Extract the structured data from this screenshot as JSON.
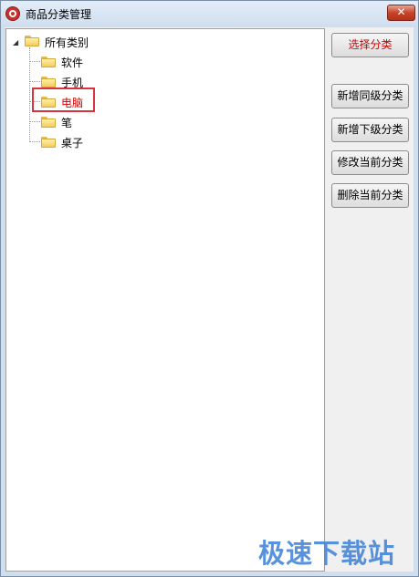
{
  "window": {
    "title": "商品分类管理",
    "close_label": "✕"
  },
  "tree": {
    "root": {
      "label": "所有类别",
      "expander": "◢",
      "expanded": true
    },
    "children": [
      {
        "label": "软件"
      },
      {
        "label": "手机"
      },
      {
        "label": "电脑",
        "selected": true
      },
      {
        "label": "笔"
      },
      {
        "label": "桌子"
      }
    ]
  },
  "buttons": {
    "select": "选择分类",
    "add_sibling": "新增同级分类",
    "add_child": "新增下级分类",
    "edit_current": "修改当前分类",
    "delete_current": "删除当前分类"
  },
  "watermark": "极速下载站",
  "colors": {
    "selected_text": "#d00000",
    "highlight_border": "#d9333f",
    "watermark": "#3d7fd6"
  }
}
